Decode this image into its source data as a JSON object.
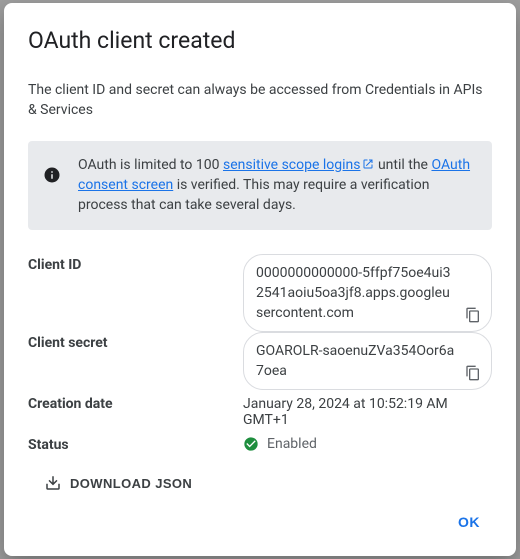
{
  "dialog": {
    "title": "OAuth client created",
    "subtitle": "The client ID and secret can always be accessed from Credentials in APIs & Services",
    "info": {
      "text_prefix": "OAuth is limited to 100 ",
      "link1": "sensitive scope logins",
      "text_mid": " until the ",
      "link2": "OAuth consent screen",
      "text_suffix": " is verified. This may require a verification process that can take several days."
    },
    "fields": {
      "client_id": {
        "label": "Client ID",
        "value": "0000000000000-5ffpf75oe4ui32541aoiu5oa3jf8.apps.googleusercontent.com"
      },
      "client_secret": {
        "label": "Client secret",
        "value": "GOAROLR-saoenuZVa354Oor6a7oea"
      },
      "creation_date": {
        "label": "Creation date",
        "value": "January 28, 2024 at 10:52:19 AM GMT+1"
      },
      "status": {
        "label": "Status",
        "value": "Enabled"
      }
    },
    "download_label": "DOWNLOAD JSON",
    "ok_label": "OK"
  }
}
